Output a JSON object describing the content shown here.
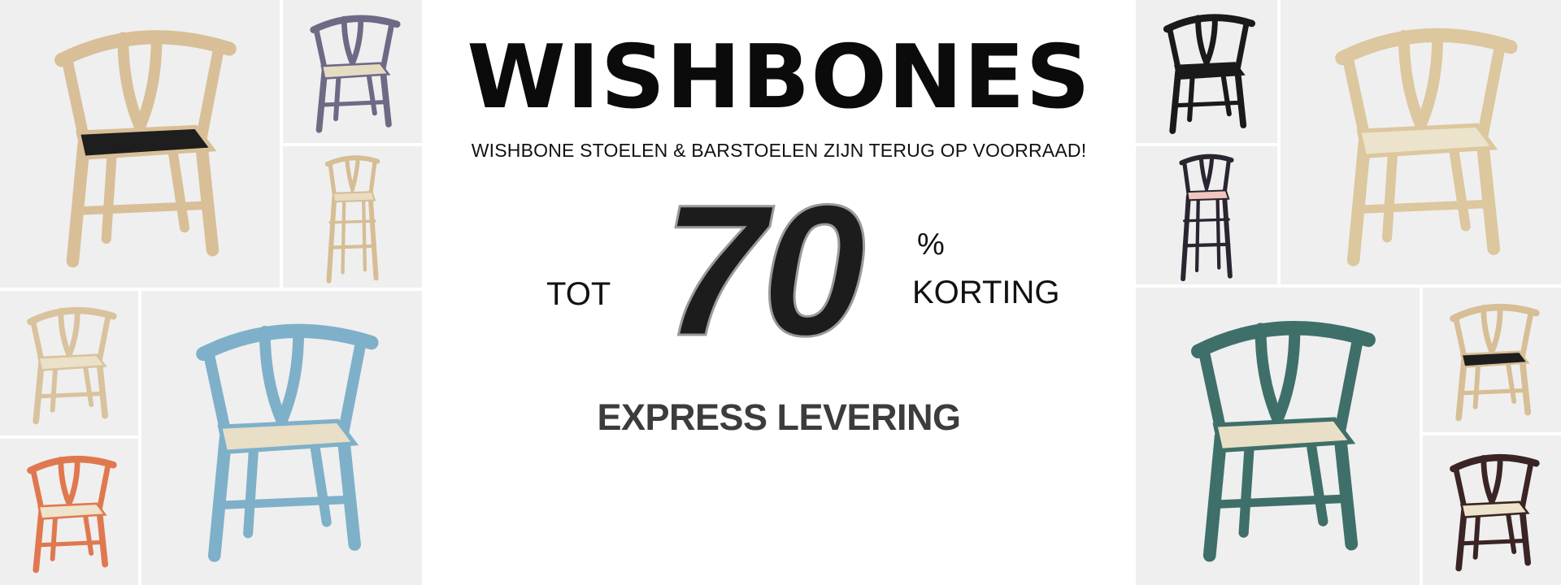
{
  "banner": {
    "brand": "WISHBONES",
    "subtitle": "WISHBONE STOELEN & BARSTOELEN ZIJN TERUG OP VOORRAAD!",
    "prefix": "TOT",
    "discount_value": "70",
    "discount_symbol": "%",
    "discount_word": "KORTING",
    "tagline": "EXPRESS LEVERING"
  },
  "tiles": [
    {
      "name": "chair-natural-black-seat",
      "frame": "#d8bf98",
      "seat": "#1e1e1e"
    },
    {
      "name": "chair-lavender",
      "frame": "#6e6a86",
      "seat": "#e6dcc4"
    },
    {
      "name": "barstool-natural",
      "frame": "#d6bd94",
      "seat": "#e8dcc2"
    },
    {
      "name": "chair-natural-small",
      "frame": "#d9c29e",
      "seat": "#ebe0c8"
    },
    {
      "name": "chair-orange",
      "frame": "#e0784f",
      "seat": "#eee3cb"
    },
    {
      "name": "chair-light-blue",
      "frame": "#7fb0c9",
      "seat": "#e9dec6"
    },
    {
      "name": "chair-black",
      "frame": "#1a1a1a",
      "seat": "#1a1a1a"
    },
    {
      "name": "barstool-dark",
      "frame": "#2a2530",
      "seat": "#f1c6c0"
    },
    {
      "name": "chair-natural-large",
      "frame": "#dcc79e",
      "seat": "#ece3cc"
    },
    {
      "name": "chair-teal",
      "frame": "#3f6f69",
      "seat": "#e9dec6"
    },
    {
      "name": "chair-natural-black-seat-small",
      "frame": "#d7be96",
      "seat": "#1e1e1e"
    },
    {
      "name": "chair-dark-brown",
      "frame": "#3a2424",
      "seat": "#ede2ca"
    }
  ]
}
